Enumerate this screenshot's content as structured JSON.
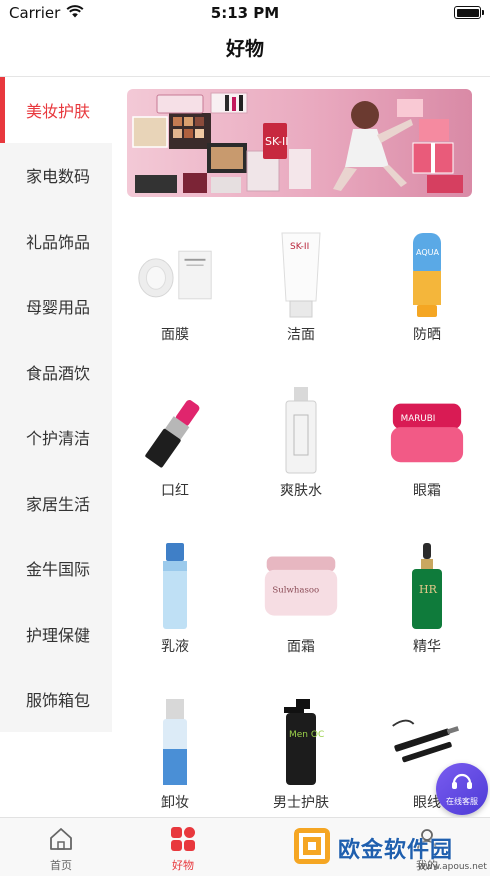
{
  "status_bar": {
    "carrier": "Carrier",
    "time": "5:13 PM"
  },
  "nav": {
    "title": "好物"
  },
  "sidebar": {
    "items": [
      {
        "label": "美妆护肤",
        "active": true
      },
      {
        "label": "家电数码"
      },
      {
        "label": "礼品饰品"
      },
      {
        "label": "母婴用品"
      },
      {
        "label": "食品酒饮"
      },
      {
        "label": "个护清洁"
      },
      {
        "label": "家居生活"
      },
      {
        "label": "金牛国际"
      },
      {
        "label": "护理保健"
      },
      {
        "label": "服饰箱包"
      }
    ]
  },
  "banner": {
    "brand_text": "SK-II"
  },
  "products": [
    {
      "label": "面膜",
      "icon": "face-mask-icon"
    },
    {
      "label": "洁面",
      "icon": "cleanser-tube-icon",
      "brand": "SK-II"
    },
    {
      "label": "防晒",
      "icon": "sunscreen-bottle-icon",
      "brand": "AQUA"
    },
    {
      "label": "口红",
      "icon": "lipstick-icon"
    },
    {
      "label": "爽肤水",
      "icon": "toner-bottle-icon"
    },
    {
      "label": "眼霜",
      "icon": "eye-cream-jar-icon",
      "brand": "MARUBI"
    },
    {
      "label": "乳液",
      "icon": "lotion-bottle-icon"
    },
    {
      "label": "面霜",
      "icon": "face-cream-jar-icon",
      "brand": "Sulwhasoo"
    },
    {
      "label": "精华",
      "icon": "serum-dropper-icon",
      "brand": "HR"
    },
    {
      "label": "卸妆",
      "icon": "makeup-remover-bottle-icon"
    },
    {
      "label": "男士护肤",
      "icon": "men-skincare-bottle-icon",
      "brand": "Men OC"
    },
    {
      "label": "眼线",
      "icon": "eyeliner-pen-icon"
    }
  ],
  "service": {
    "label": "在线客服"
  },
  "tabbar": {
    "items": [
      {
        "label": "首页",
        "icon": "home-icon"
      },
      {
        "label": "好物",
        "icon": "grid-icon",
        "active": true
      },
      {
        "label": "",
        "icon": "cart-icon"
      },
      {
        "label": "我的",
        "icon": "user-icon"
      }
    ]
  },
  "watermark": {
    "text": "欧金软件园",
    "sub": "www.apous.net"
  },
  "colors": {
    "accent": "#e8383d",
    "sidebar_bg": "#f5f5f5",
    "service": "#5a44e0",
    "watermark": "#1f5fae"
  }
}
